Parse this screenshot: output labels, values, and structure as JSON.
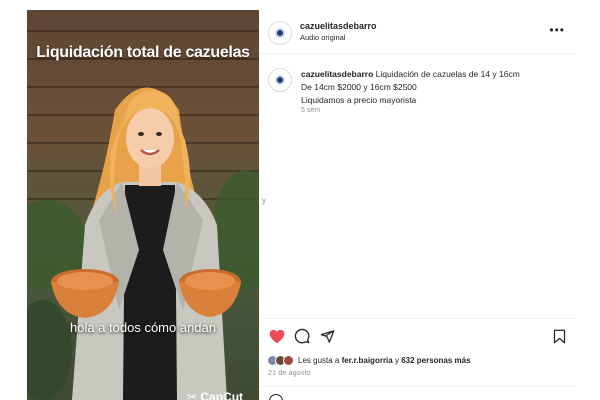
{
  "video": {
    "title": "Liquidación total de cazuelas",
    "caption": "hola a todos cómo andan",
    "watermark": "CapCut"
  },
  "post": {
    "username": "cazuelitasdebarro",
    "audio": "Audio original",
    "more_icon": "more-horizontal-icon",
    "caption_lines": [
      "Liquidación de cazuelas de 14 y 16cm",
      "De 14cm $2000 y 16cm $2500",
      "Liquidamos a precio mayorista"
    ],
    "time_ago": "5 sem",
    "edge_char": "y",
    "likes": {
      "prefix": "Les gusta a ",
      "user": "fer.r.baigorria",
      "middle": " y ",
      "others": "632 personas más"
    },
    "date": "21 de agosto"
  },
  "icons": {
    "like": "heart-icon",
    "comment": "comment-icon",
    "share": "send-icon",
    "save": "bookmark-icon"
  },
  "colors": {
    "like_red": "#ed4956",
    "muted_text": "#8e8e8e",
    "avatar_blue": "#1d3f7a"
  }
}
